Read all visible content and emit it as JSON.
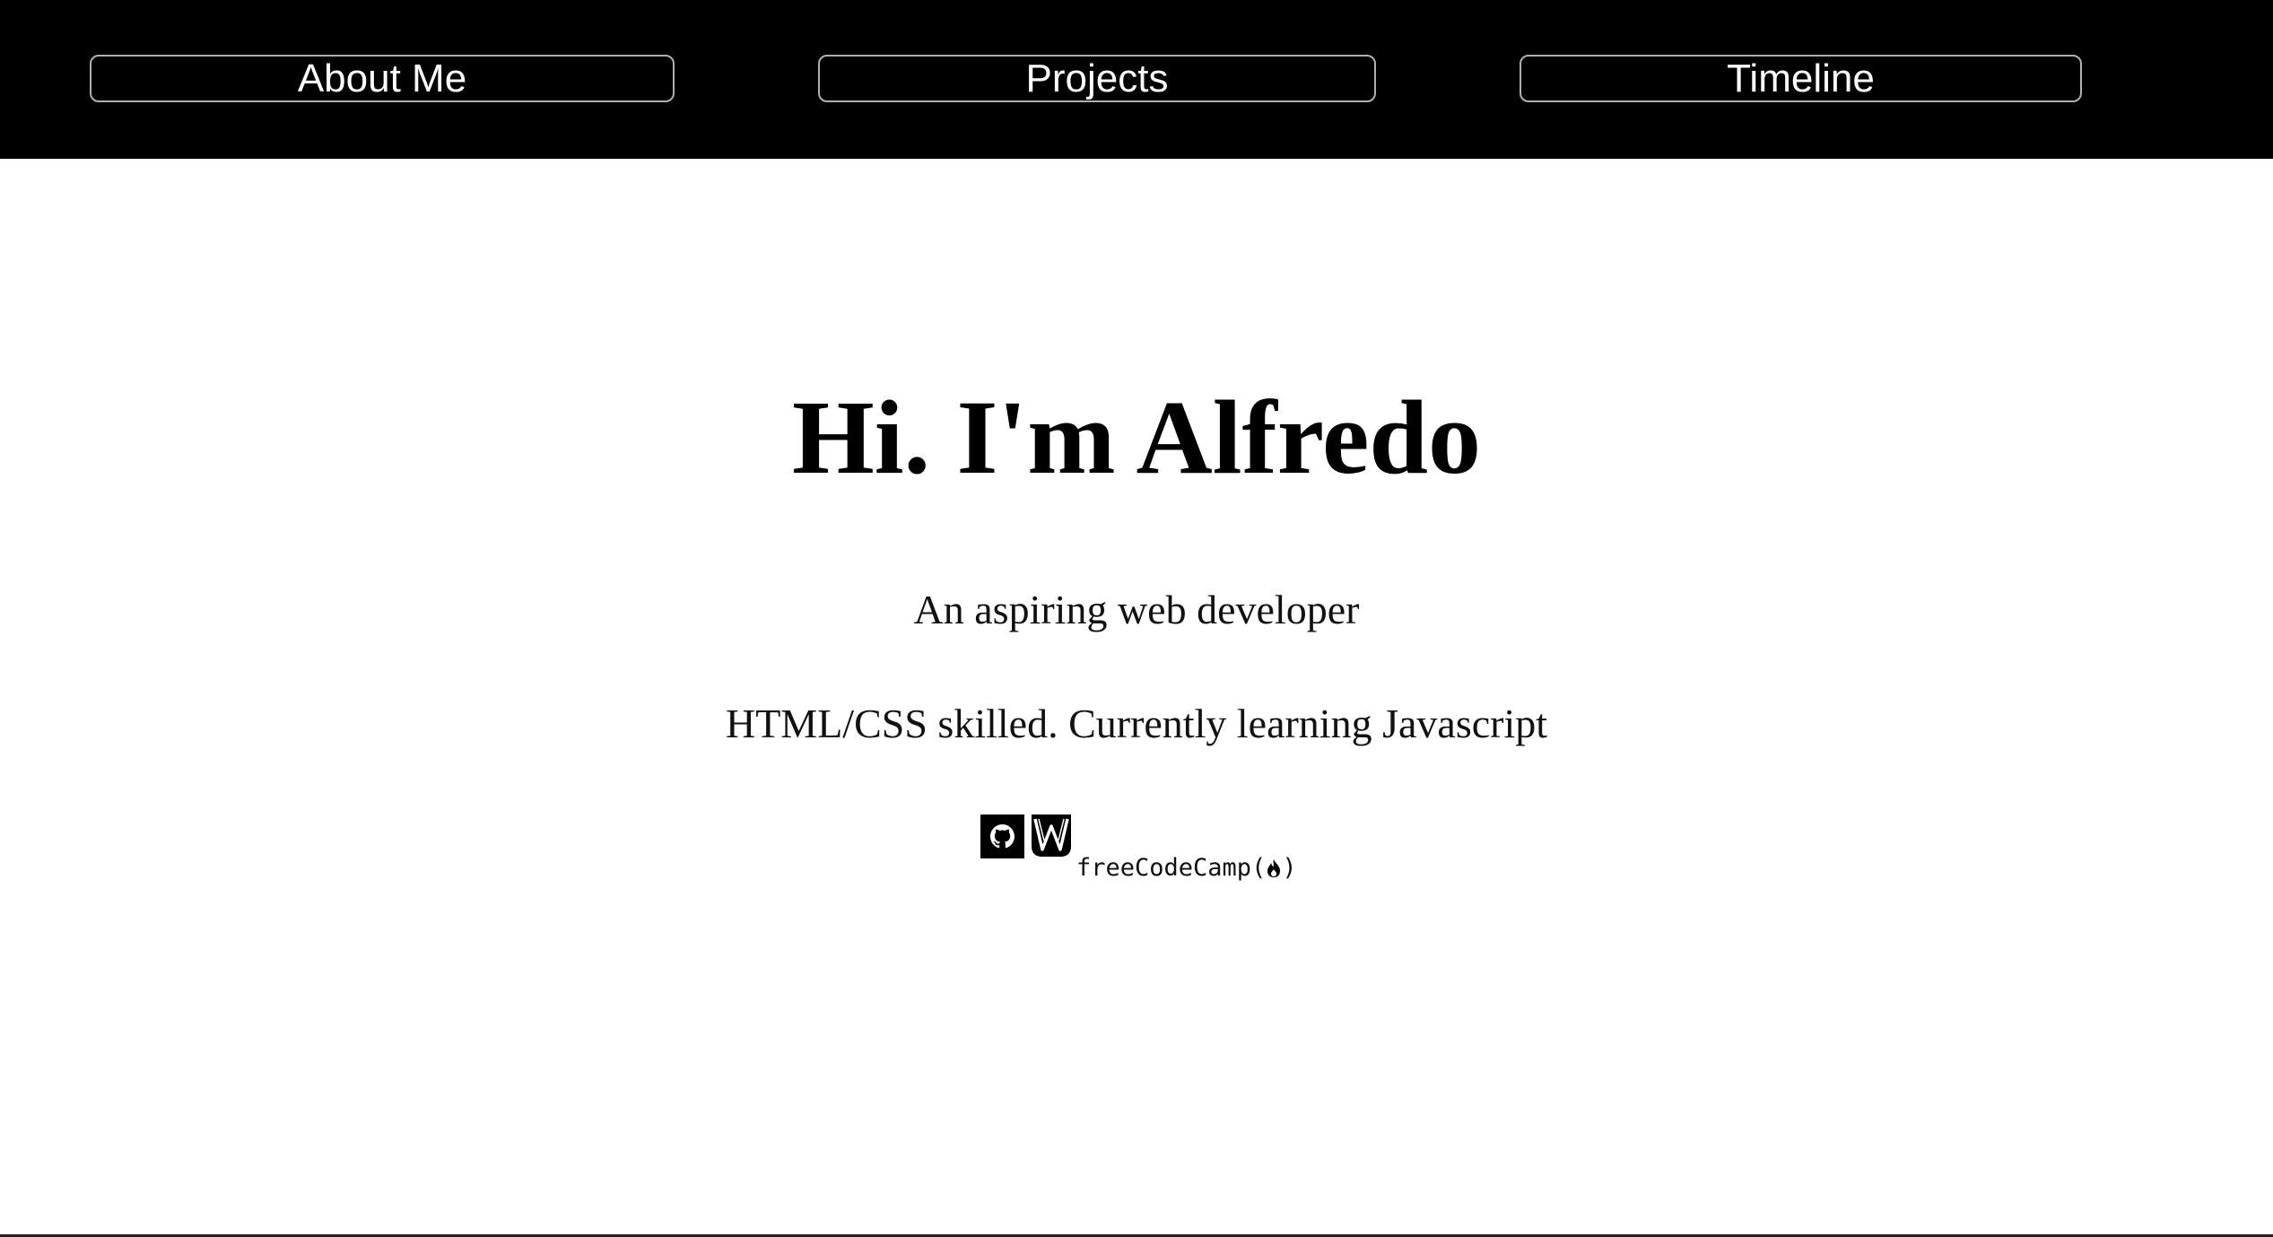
{
  "nav": {
    "items": [
      {
        "label": "About Me"
      },
      {
        "label": "Projects"
      },
      {
        "label": "Timeline"
      }
    ]
  },
  "hero": {
    "title": "Hi. I'm Alfredo",
    "subtitle": "An aspiring web developer",
    "skills": "HTML/CSS skilled. Currently learning Javascript"
  },
  "socials": {
    "github_icon": "github-icon",
    "wordpress_icon": "wordpress-icon",
    "fcc_text": "freeCodeCamp(",
    "fcc_close": ")",
    "fcc_icon": "flame-icon"
  },
  "colors": {
    "nav_background": "#000000",
    "nav_border": "#b0b0b0",
    "page_background": "#ffffff",
    "text": "#000000"
  }
}
